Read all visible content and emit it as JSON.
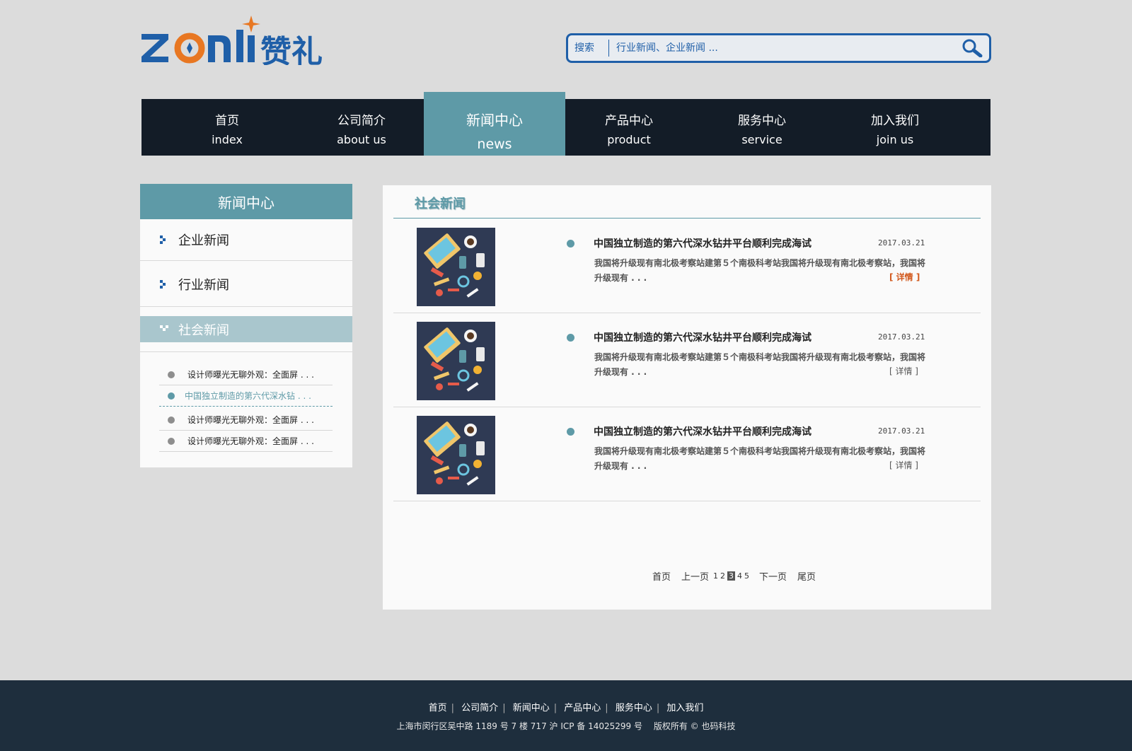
{
  "brand": {
    "logo_latin": "zcnli",
    "logo_cn": "赞礼",
    "colors": {
      "blue": "#1f5fa8",
      "orange": "#e87722"
    }
  },
  "search": {
    "label": "搜索",
    "placeholder": "行业新闻、企业新闻 ...",
    "icon": "search-icon"
  },
  "nav": [
    {
      "cn": "首页",
      "en": "index"
    },
    {
      "cn": "公司简介",
      "en": "about us"
    },
    {
      "cn": "新闻中心",
      "en": "news",
      "active": true
    },
    {
      "cn": "产品中心",
      "en": "product"
    },
    {
      "cn": "服务中心",
      "en": "service"
    },
    {
      "cn": "加入我们",
      "en": "join us"
    }
  ],
  "sidebar": {
    "title": "新闻中心",
    "items": [
      {
        "label": "企业新闻"
      },
      {
        "label": "行业新闻"
      },
      {
        "label": "社会新闻",
        "active": true
      }
    ],
    "sub_items": [
      {
        "label": "设计师曝光无聊外观：全面屏 . . ."
      },
      {
        "label": "中国独立制造的第六代深水钻 . . .",
        "active": true
      },
      {
        "label": "设计师曝光无聊外观：全面屏 . . ."
      },
      {
        "label": "设计师曝光无聊外观：全面屏 . . ."
      }
    ]
  },
  "content": {
    "title": "社会新闻",
    "news": [
      {
        "title": "中国独立制造的第六代深水钻井平台顺利完成海试",
        "date": "2017.03.21",
        "desc": "我国将升级现有南北极考察站建第５个南极科考站我国将升级现有南北极考察站，我国将升级现有 . . .",
        "more": "[ 详情 ]",
        "more_hot": true
      },
      {
        "title": "中国独立制造的第六代深水钻井平台顺利完成海试",
        "date": "2017.03.21",
        "desc": "我国将升级现有南北极考察站建第５个南极科考站我国将升级现有南北极考察站，我国将升级现有 . . .",
        "more": "[ 详情 ]",
        "more_hot": false
      },
      {
        "title": "中国独立制造的第六代深水钻井平台顺利完成海试",
        "date": "2017.03.21",
        "desc": "我国将升级现有南北极考察站建第５个南极科考站我国将升级现有南北极考察站，我国将升级现有 . . .",
        "more": "[ 详情 ]",
        "more_hot": false
      }
    ],
    "pager": {
      "first": "首页",
      "prev": "上一页",
      "pages": [
        "1",
        "2",
        "3",
        "4",
        "5"
      ],
      "current": "3",
      "next": "下一页",
      "last": "尾页"
    }
  },
  "footer": {
    "links": [
      "首页",
      "公司简介",
      "新闻中心",
      "产品中心",
      "服务中心",
      "加入我们"
    ],
    "copyright": "上海市闵行区吴中路 1189 号 7 楼 717 沪 ICP 备 14025299 号　 版权所有 © 也码科技"
  }
}
